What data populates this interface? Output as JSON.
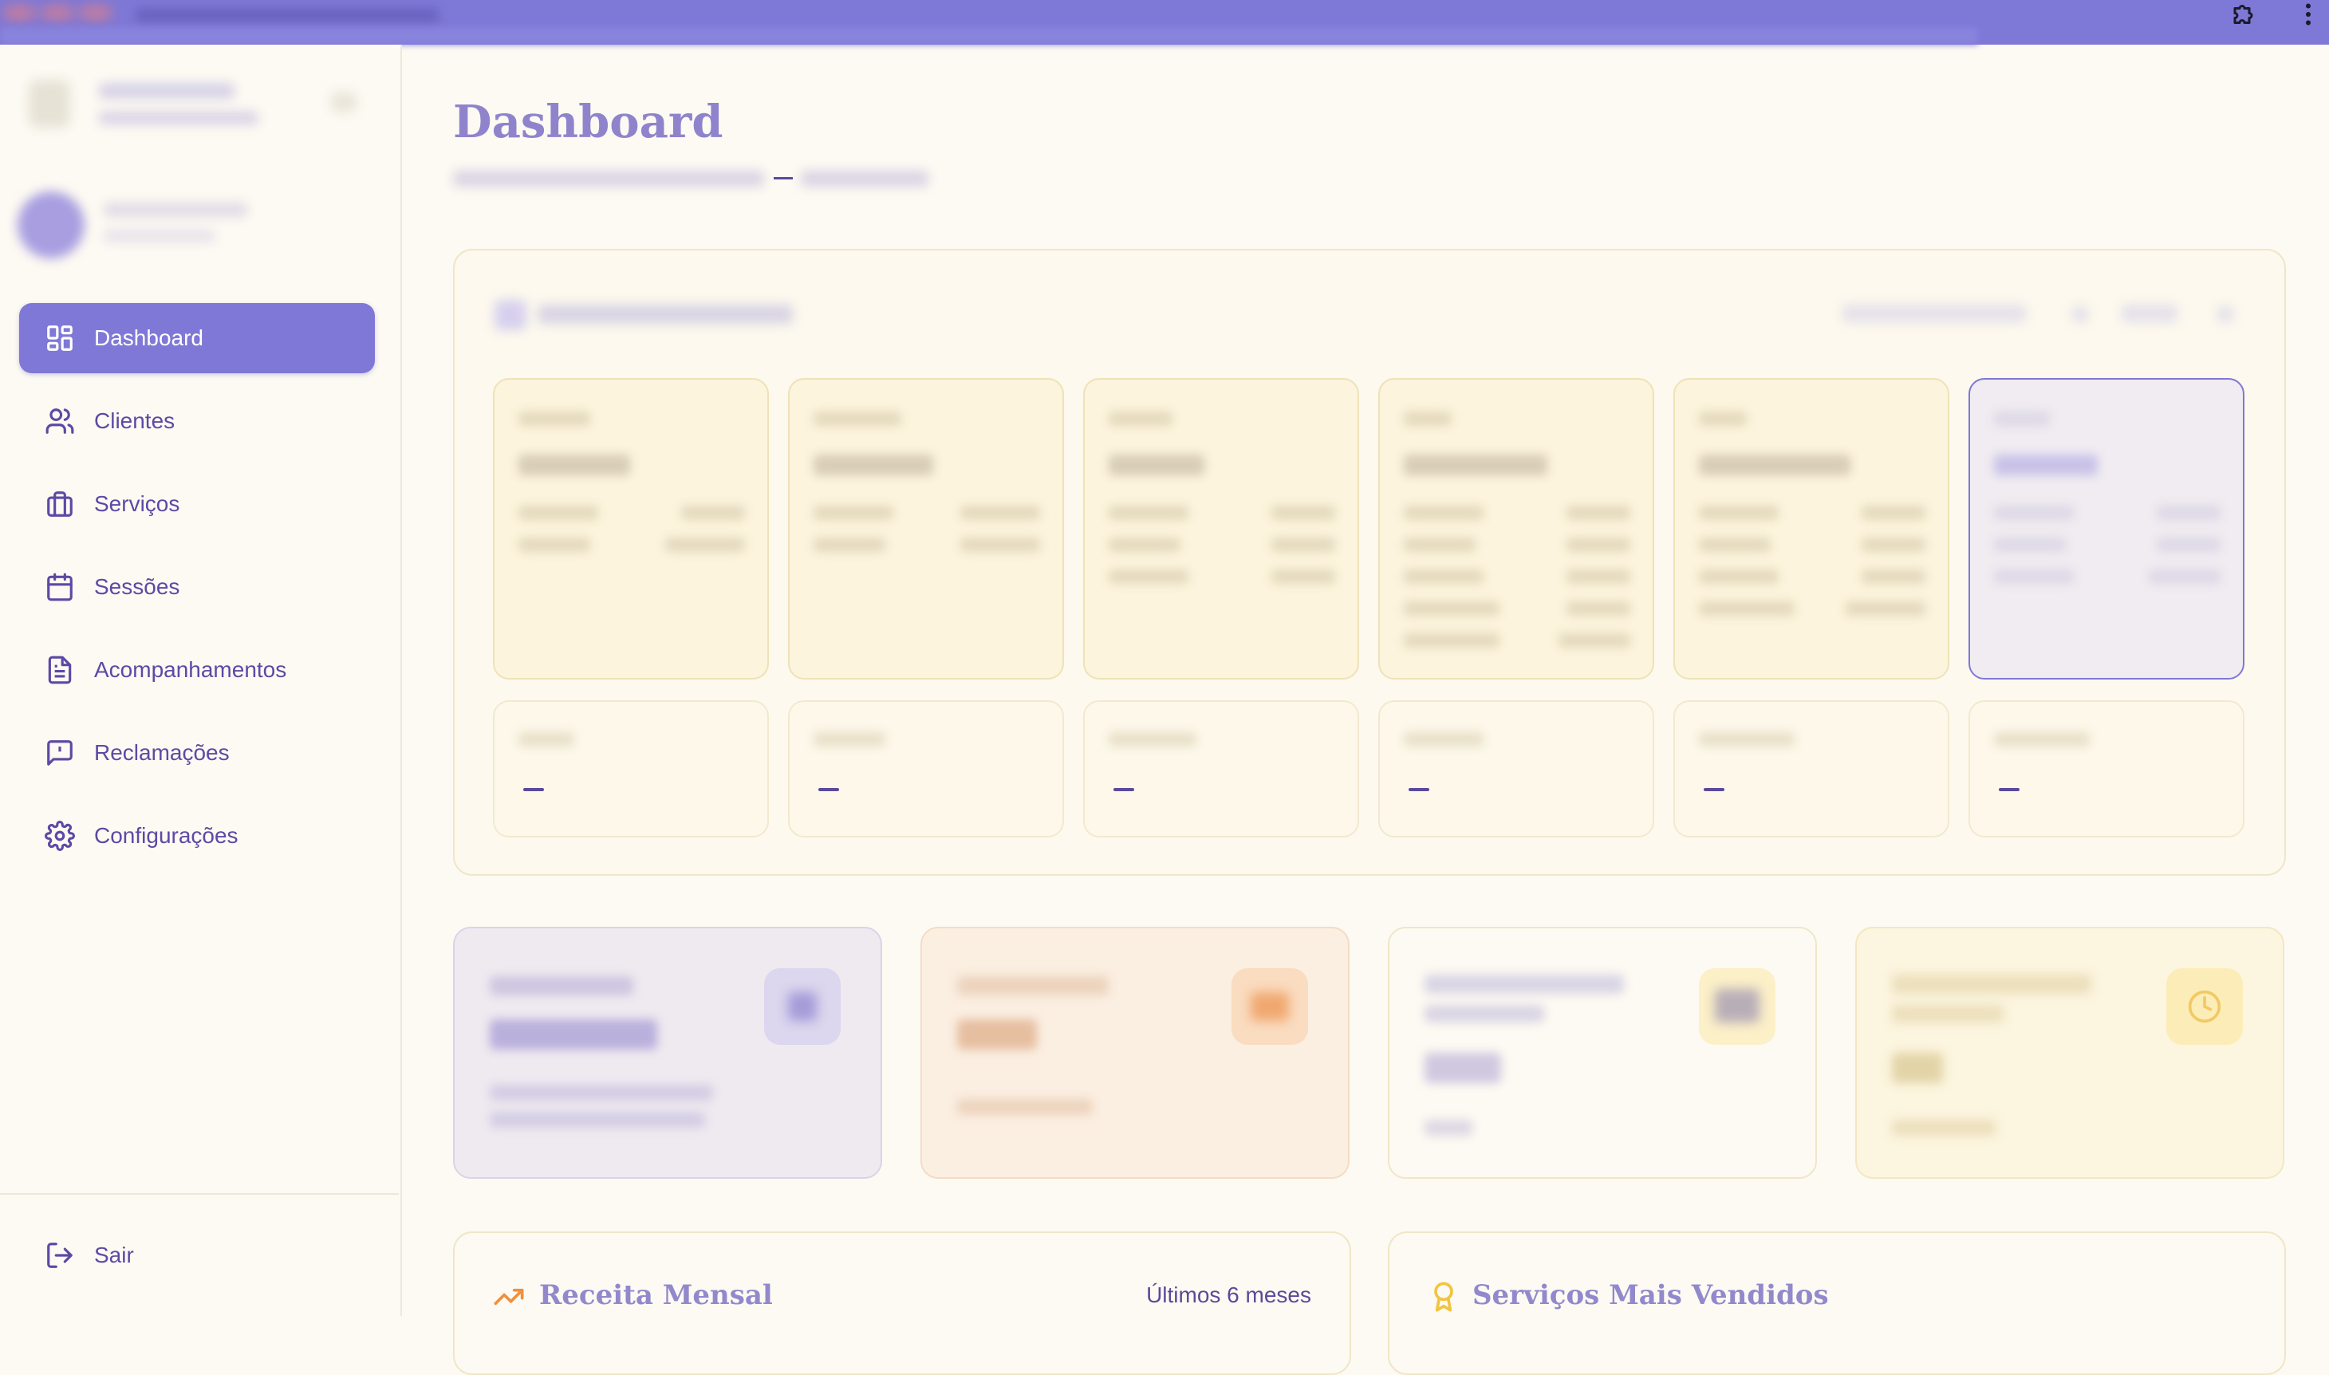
{
  "sidebar": {
    "items": [
      {
        "label": "Dashboard",
        "icon": "dashboard-grid-icon",
        "active": true
      },
      {
        "label": "Clientes",
        "icon": "users-icon",
        "active": false
      },
      {
        "label": "Serviços",
        "icon": "briefcase-icon",
        "active": false
      },
      {
        "label": "Sessões",
        "icon": "calendar-icon",
        "active": false
      },
      {
        "label": "Acompanhamentos",
        "icon": "document-icon",
        "active": false
      },
      {
        "label": "Reclamações",
        "icon": "message-alert-icon",
        "active": false
      },
      {
        "label": "Configurações",
        "icon": "gear-icon",
        "active": false
      }
    ],
    "logout_label": "Sair"
  },
  "page": {
    "title": "Dashboard"
  },
  "panels": {
    "revenue": {
      "title": "Receita Mensal",
      "range": "Últimos 6 meses",
      "icon": "trending-up-icon"
    },
    "top_services": {
      "title": "Serviços Mais Vendidos",
      "icon": "award-icon"
    }
  },
  "colors": {
    "accent": "#7f78d6",
    "background": "#fdfaf3",
    "text": "#5a4a9a",
    "title": "#8f84cc"
  }
}
